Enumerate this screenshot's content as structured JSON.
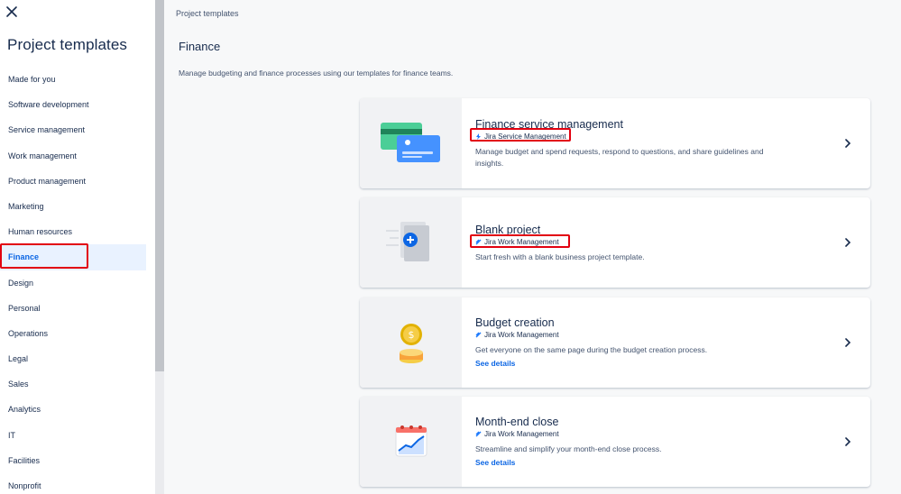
{
  "sidebar": {
    "close_icon": "close-icon",
    "title": "Project templates",
    "items": [
      {
        "label": "Made for you"
      },
      {
        "label": "Software development"
      },
      {
        "label": "Service management"
      },
      {
        "label": "Work management"
      },
      {
        "label": "Product management"
      },
      {
        "label": "Marketing"
      },
      {
        "label": "Human resources"
      },
      {
        "label": "Finance",
        "active": true
      },
      {
        "label": "Design"
      },
      {
        "label": "Personal"
      },
      {
        "label": "Operations"
      },
      {
        "label": "Legal"
      },
      {
        "label": "Sales"
      },
      {
        "label": "Analytics"
      },
      {
        "label": "IT"
      },
      {
        "label": "Facilities"
      },
      {
        "label": "Nonprofit"
      }
    ]
  },
  "main": {
    "breadcrumb": "Project templates",
    "title": "Finance",
    "description": "Manage budgeting and finance processes using our templates for finance teams.",
    "cards": [
      {
        "title": "Finance service management",
        "product": "Jira Service Management",
        "description": "Manage budget and spend requests, respond to questions, and share guidelines and insights.",
        "icon": "credit-cards-icon"
      },
      {
        "title": "Blank project",
        "product": "Jira Work Management",
        "description": "Start fresh with a blank business project template.",
        "icon": "blank-project-icon"
      },
      {
        "title": "Budget creation",
        "product": "Jira Work Management",
        "description": "Get everyone on the same page during the budget creation process.",
        "link": "See details",
        "icon": "coins-icon"
      },
      {
        "title": "Month-end close",
        "product": "Jira Work Management",
        "description": "Streamline and simplify your month-end close process.",
        "link": "See details",
        "icon": "calendar-chart-icon"
      }
    ]
  },
  "colors": {
    "accent": "#0c66e4",
    "highlight_box": "#e2000f",
    "active_bg": "#e9f2ff"
  }
}
